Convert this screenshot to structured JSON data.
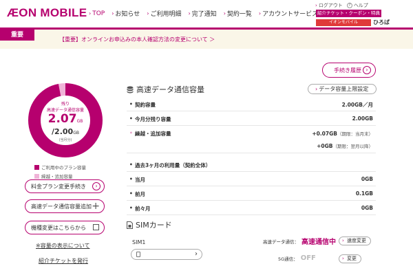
{
  "header": {
    "logo": "ÆON MOBILE",
    "nav": [
      "TOP",
      "お知らせ",
      "ご利用明細",
      "完了通知",
      "契約一覧",
      "アカウントサービス"
    ],
    "logout": "ログアウト",
    "help": "ヘルプ",
    "ticket": "紹介チケット・クーポン・特典",
    "hiroba_logo": "イオンモバイル",
    "hiroba_text": "ひろば"
  },
  "notice": {
    "badge": "重要",
    "text": "【重要】オンラインお申込みの本人確認方法の変更について ＞"
  },
  "usage_donut": {
    "remain_label": "残り",
    "data_label": "高速データ通信容量",
    "remaining_value": "2.07",
    "remaining_unit": "GB",
    "total_value": "/2.00",
    "total_unit": "GB",
    "per_month": "(当月分)",
    "plan_fraction": 0.97,
    "carryover_fraction": 0.03
  },
  "legend": [
    {
      "label": "ご利用中のプラン容量",
      "color": "#b6006e"
    },
    {
      "label": "繰越・追加容量",
      "color": "#f0b4d8"
    }
  ],
  "side": {
    "plan_change": "料金プラン変更手続き",
    "data_add": "高速データ通信容量追加",
    "device_change": "機種変更はこちらから",
    "display_note": "※容量の表示について",
    "issue_ticket": "紹介チケットを発行"
  },
  "proc_history": "手続き履歴",
  "capacity": {
    "title": "高速データ通信容量",
    "limit_btn": "データ容量上限設定",
    "contract_label": "契約容量",
    "contract_value": "2.00GB／月",
    "month_remain_label": "今月分残り容量",
    "month_remain_value": "2.00GB",
    "carry_label": "繰越・追加容量",
    "carry_value1": "+0.07GB",
    "carry_note1": "（期限：当月末）",
    "carry_value2": "+0GB",
    "carry_note2": "（期限：翌月以降）",
    "past_title": "過去3ヶ月の利用量（契約全体）",
    "past": [
      {
        "label": "当月",
        "value": "0GB"
      },
      {
        "label": "前月",
        "value": "0.1GB"
      },
      {
        "label": "前々月",
        "value": "0GB"
      }
    ]
  },
  "sim": {
    "title": "SIMカード",
    "name": "SIM1",
    "speed_label": "高速データ通信：",
    "speed_value": "高速通信中",
    "speed_btn": "速度変更",
    "fiveg_label": "5G通信：",
    "fiveg_value": "OFF",
    "fiveg_btn": "変更"
  },
  "colors": {
    "accent": "#b6006e",
    "carryover": "#f0b4d8",
    "notice_bg": "#faf6e8"
  }
}
